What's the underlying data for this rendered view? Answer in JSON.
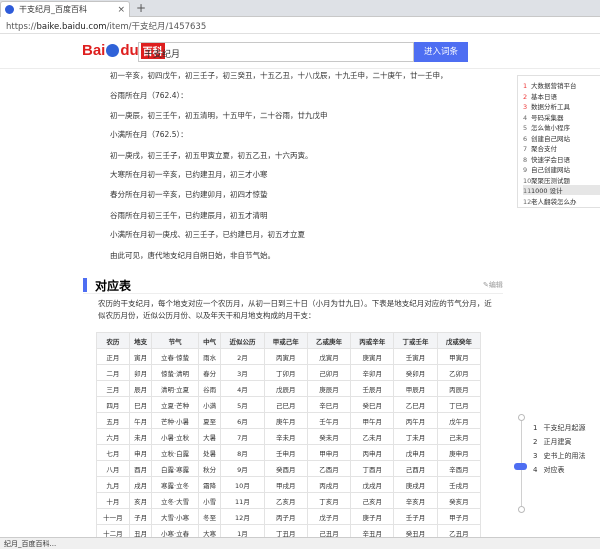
{
  "browser": {
    "tab_title": "干支纪月_百度百科",
    "close_glyph": "×",
    "new_tab_glyph": "+",
    "url_prefix": "https://",
    "url_host": "baike.baidu.com",
    "url_path": "/item/干支纪月/1457635"
  },
  "header": {
    "logo_text_a": "Bai",
    "logo_text_b": "du",
    "logo_text_c": "百科",
    "search_value": "干支纪月",
    "search_button": "进入词条"
  },
  "article": {
    "lines": [
      "初一辛亥，初四戊午，初三壬子，初三癸丑，十五乙丑，十八戊辰，十九壬申，二十庚午，廿一壬申，",
      "谷雨所在月（762.4）：",
      "初一庚辰，初三壬午，初五清明，十五甲午，二十谷雨，廿九戊申",
      "小满所在月（762.5）：",
      "初一庚戌，初三壬子，初五甲寅立夏，初五乙丑，十六丙寅。",
      "大寒所在月初一辛亥，已约建丑月，初三才小寒",
      "春分所在月初一辛亥，已约建卯月，初四才惊蛰",
      "谷雨所在月初三壬午，已约建辰月，初五才清明",
      "小满所在月初一庚戌、初三壬子，已约建巳月，初五才立夏",
      "由此可见，唐代地支纪月自朔日始，非自节气始。"
    ],
    "section_title": "对应表",
    "edit_label": "✎编辑",
    "intro": "农历的干支纪月，每个地支对应一个农历月，从初一日到三十日（小月为廿九日）。下表是地支纪月对应的节气分月，近似农历月份，近似公历月份、以及年天干和月地支构成的月干支："
  },
  "table": {
    "headers": [
      "农历",
      "地支",
      "节气",
      "中气",
      "近似公历",
      "甲或己年",
      "乙或庚年",
      "丙或辛年",
      "丁或壬年",
      "戊或癸年"
    ],
    "rows": [
      [
        "正月",
        "寅月",
        "立春·惊蛰",
        "雨水",
        "2月",
        "丙寅月",
        "戊寅月",
        "庚寅月",
        "壬寅月",
        "甲寅月"
      ],
      [
        "二月",
        "卯月",
        "惊蛰·清明",
        "春分",
        "3月",
        "丁卯月",
        "己卯月",
        "辛卯月",
        "癸卯月",
        "乙卯月"
      ],
      [
        "三月",
        "辰月",
        "清明·立夏",
        "谷雨",
        "4月",
        "戊辰月",
        "庚辰月",
        "壬辰月",
        "甲辰月",
        "丙辰月"
      ],
      [
        "四月",
        "巳月",
        "立夏·芒种",
        "小满",
        "5月",
        "己巳月",
        "辛巳月",
        "癸巳月",
        "乙巳月",
        "丁巳月"
      ],
      [
        "五月",
        "午月",
        "芒种·小暑",
        "夏至",
        "6月",
        "庚午月",
        "壬午月",
        "甲午月",
        "丙午月",
        "戊午月"
      ],
      [
        "六月",
        "未月",
        "小暑·立秋",
        "大暑",
        "7月",
        "辛未月",
        "癸未月",
        "乙未月",
        "丁未月",
        "己未月"
      ],
      [
        "七月",
        "申月",
        "立秋·白露",
        "处暑",
        "8月",
        "壬申月",
        "甲申月",
        "丙申月",
        "戊申月",
        "庚申月"
      ],
      [
        "八月",
        "酉月",
        "白露·寒露",
        "秋分",
        "9月",
        "癸酉月",
        "乙酉月",
        "丁酉月",
        "己酉月",
        "辛酉月"
      ],
      [
        "九月",
        "戌月",
        "寒露·立冬",
        "霜降",
        "10月",
        "甲戌月",
        "丙戌月",
        "戊戌月",
        "庚戌月",
        "壬戌月"
      ],
      [
        "十月",
        "亥月",
        "立冬·大雪",
        "小雪",
        "11月",
        "乙亥月",
        "丁亥月",
        "己亥月",
        "辛亥月",
        "癸亥月"
      ],
      [
        "十一月",
        "子月",
        "大雪·小寒",
        "冬至",
        "12月",
        "丙子月",
        "戊子月",
        "庚子月",
        "壬子月",
        "甲子月"
      ],
      [
        "十二月",
        "丑月",
        "小寒·立春",
        "大寒",
        "1月",
        "丁丑月",
        "己丑月",
        "辛丑月",
        "癸丑月",
        "乙丑月"
      ]
    ]
  },
  "sidebar": {
    "hot": [
      {
        "n": "1",
        "label": "大数据营销平台"
      },
      {
        "n": "2",
        "label": "基本日语"
      },
      {
        "n": "3",
        "label": "数据分析工具"
      },
      {
        "n": "4",
        "label": "号码采集器"
      },
      {
        "n": "5",
        "label": "怎么做小程序"
      },
      {
        "n": "6",
        "label": "创建自己网站"
      },
      {
        "n": "7",
        "label": "聚合支付"
      },
      {
        "n": "8",
        "label": "快速学会日语"
      },
      {
        "n": "9",
        "label": "自己创建网站"
      },
      {
        "n": "10",
        "label": "聚聚压测试题"
      },
      {
        "n": "11",
        "label": "1000 设计"
      },
      {
        "n": "12",
        "label": "老人翻袋怎么办"
      }
    ],
    "toc": [
      {
        "n": "1",
        "label": "干支纪月起源"
      },
      {
        "n": "2",
        "label": "正月建寅"
      },
      {
        "n": "3",
        "label": "史书上的用法"
      },
      {
        "n": "4",
        "label": "对应表"
      }
    ]
  },
  "status": {
    "text": "纪月_百度百科..."
  },
  "colors": {
    "accent": "#4e6ef2",
    "hot_rank": "#e33333"
  }
}
